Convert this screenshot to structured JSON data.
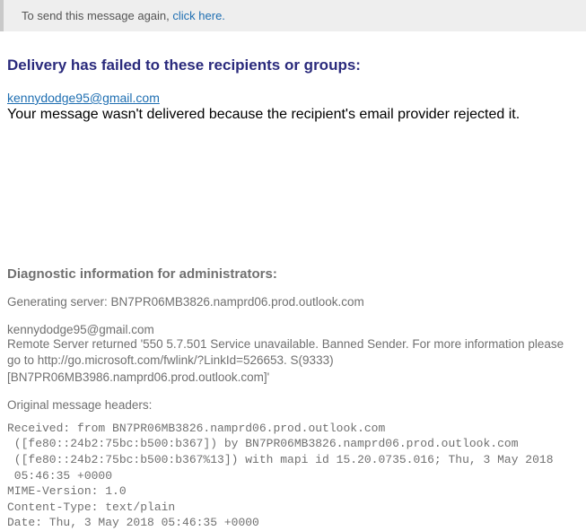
{
  "resend": {
    "prefix": "To send this message again, ",
    "link_text": "click here."
  },
  "failure": {
    "heading": "Delivery has failed to these recipients or groups:",
    "recipient_email": "kennydodge95@gmail.com",
    "reason": "Your message wasn't delivered because the recipient's email provider rejected it."
  },
  "diagnostics": {
    "heading": "Diagnostic information for administrators:",
    "generating_server_line": "Generating server: BN7PR06MB3826.namprd06.prod.outlook.com",
    "recipient_line": "kennydodge95@gmail.com",
    "remote_error": "Remote Server returned '550 5.7.501 Service unavailable. Banned Sender. For more information please go to http://go.microsoft.com/fwlink/?LinkId=526653. S(9333) [BN7PR06MB3986.namprd06.prod.outlook.com]'",
    "original_headers_label": "Original message headers:",
    "headers": "Received: from BN7PR06MB3826.namprd06.prod.outlook.com\n ([fe80::24b2:75bc:b500:b367]) by BN7PR06MB3826.namprd06.prod.outlook.com\n ([fe80::24b2:75bc:b500:b367%13]) with mapi id 15.20.0735.016; Thu, 3 May 2018\n 05:46:35 +0000\nMIME-Version: 1.0\nContent-Type: text/plain\nDate: Thu, 3 May 2018 05:46:35 +0000"
  }
}
